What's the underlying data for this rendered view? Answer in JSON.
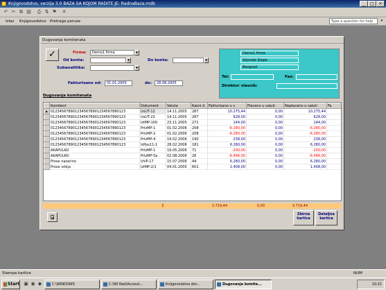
{
  "window": {
    "title": "Knjigovodstvo, verzija 3.0   BAZA SA KOJOM RADITE JE: RadnaBaza.mdb"
  },
  "menu": {
    "items": [
      "Izlaz",
      "Knjigovodstvo",
      "Pretraga poruze"
    ],
    "help_placeholder": "Type a question for help"
  },
  "form": {
    "title": "Dugovanja komitenata",
    "firma_label": "Firma:",
    "firma_value": "Demo1 firma",
    "od_konta_label": "Od konta:",
    "do_konta_label": "Do konta:",
    "subanalitika_label": "Subanalitika:",
    "fakturisano_label": "Fakturisano od:",
    "date_from": "01.01.2005",
    "do_label": "do:",
    "date_to": "28.08.2005",
    "section_title": "Dugovanja komitenata"
  },
  "info": {
    "name": "Demo1 firma",
    "address": "Vojvode Stepe",
    "city": "Beograd",
    "tel_label": "Tel:",
    "fax_label": "Fax:",
    "director_label": "Direktor vlasnik:"
  },
  "grid": {
    "columns": [
      "Komitent",
      "Dokument",
      "Valuta",
      "Kasni d",
      "Fakturisano u v",
      "Placeno u valuti",
      "Neplaceno u valuti",
      "Fa"
    ],
    "rows": [
      [
        "0123456789012345678901234567890123",
        "UsUT-12",
        "14.11.2005",
        "287",
        "10.275,44",
        "0,00",
        "10.275,44",
        "",
        "pos"
      ],
      [
        "0123456789012345678901234567890123",
        "UsUT-23",
        "14.11.2005",
        "287",
        "628,00",
        "0,00",
        "628,00",
        "",
        "pos"
      ],
      [
        "0123456789012345678901234567890123",
        "IzIMP-100",
        "23.11.2005",
        "271",
        "144,00",
        "0,00",
        "144,00",
        "",
        "pos"
      ],
      [
        "0123456789012345678901234567890123",
        "PrIzMP-1",
        "01.02.2006",
        "208",
        "-6.280,00",
        "0,00",
        "-6.280,00",
        "",
        "neg"
      ],
      [
        "0123456789012345678901234567890123",
        "PrIzMP-2",
        "01.02.2006",
        "208",
        "-6.280,00",
        "0,00",
        "-6.280,00",
        "",
        "neg"
      ],
      [
        "0123456789012345678901234567890123",
        "PrIzMP-4",
        "19.02.2006",
        "190",
        "238,00",
        "0,00",
        "238,00",
        "",
        "pos"
      ],
      [
        "0123456789012345678901234567890123",
        "IzPps11-1",
        "28.02.2006",
        "181",
        "6.280,00",
        "0,00",
        "6.280,00",
        "",
        "pos"
      ],
      [
        "AKAPULKO",
        "PrIzMP-1",
        "19.05.2006",
        "71",
        "-200,00",
        "0,00",
        "-200,00",
        "",
        "neg"
      ],
      [
        "AKAPULKO",
        "PrIzMP-5a",
        "02.08.2006",
        "26",
        "-6.496,00",
        "0,00",
        "-6.496,00",
        "",
        "neg"
      ],
      [
        "Prose nazarino",
        "IzVP-17",
        "15.07.2006",
        "44",
        "6.280,00",
        "0,00",
        "6.280,00",
        "",
        "pos"
      ],
      [
        "Prose srbija",
        "IzIMP-2/1",
        "04.01.2005",
        "601",
        "1.408,00",
        "0,00",
        "1.408,00",
        "",
        "pos"
      ]
    ],
    "sum_symbol": "Σ",
    "sum_fakturisano": "3.719,44",
    "sum_placeno": "0,00",
    "sum_neplaceno": "3.719,44"
  },
  "buttons": {
    "zbirna": "Zbirna kartica",
    "detaljna": "Detaljna kartica"
  },
  "status": {
    "left": "Stampa kartice",
    "num": "NUM"
  },
  "taskbar": {
    "start": "Start",
    "tasks": [
      "C:\\WINDOWS",
      "C:\\WI Rad\\Access\\...",
      "Knjigovodstvo.doc...",
      "Dugovanja komite..."
    ],
    "clock": "10:21"
  }
}
